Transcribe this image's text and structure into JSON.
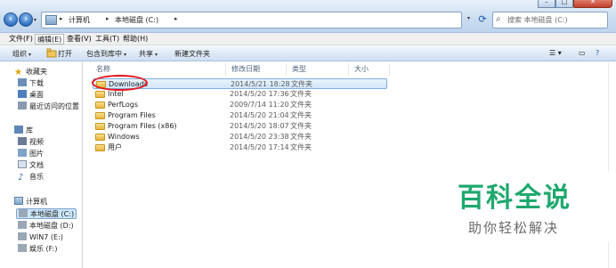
{
  "address": {
    "segments": [
      "计算机",
      "本地磁盘 (C:)"
    ],
    "search_placeholder": "搜索 本地磁盘 (C:)"
  },
  "menu": [
    "文件(F)",
    "编辑(E)",
    "查看(V)",
    "工具(T)",
    "帮助(H)"
  ],
  "toolbar": {
    "organize": "组织",
    "open": "打开",
    "include": "包含到库中",
    "share": "共享",
    "new_folder": "新建文件夹"
  },
  "nav": {
    "favorites": {
      "title": "收藏夹",
      "items": [
        "下载",
        "桌面",
        "最近访问的位置"
      ]
    },
    "libraries": {
      "title": "库",
      "items": [
        "视频",
        "图片",
        "文档",
        "音乐"
      ]
    },
    "computer": {
      "title": "计算机",
      "items": [
        "本地磁盘 (C:)",
        "本地磁盘 (D:)",
        "WIN7 (E:)",
        "娱乐 (F:)"
      ]
    }
  },
  "columns": {
    "name": "名称",
    "date": "修改日期",
    "type": "类型",
    "size": "大小"
  },
  "files": [
    {
      "name": "Downloads",
      "date": "2014/5/21 18:28",
      "type": "文件夹"
    },
    {
      "name": "Intel",
      "date": "2014/5/20 17:36",
      "type": "文件夹"
    },
    {
      "name": "PerfLogs",
      "date": "2009/7/14 11:20",
      "type": "文件夹"
    },
    {
      "name": "Program Files",
      "date": "2014/5/20 21:04",
      "type": "文件夹"
    },
    {
      "name": "Program Files (x86)",
      "date": "2014/5/20 18:07",
      "type": "文件夹"
    },
    {
      "name": "Windows",
      "date": "2014/5/20 23:38",
      "type": "文件夹"
    },
    {
      "name": "用户",
      "date": "2014/5/20 17:14",
      "type": "文件夹"
    }
  ],
  "watermark": {
    "title": "百科全说",
    "subtitle": "助你轻松解决"
  },
  "colors": {
    "accent": "#1fa86e",
    "highlight_oval": "#e8141b",
    "selection": "#cde8fb"
  }
}
